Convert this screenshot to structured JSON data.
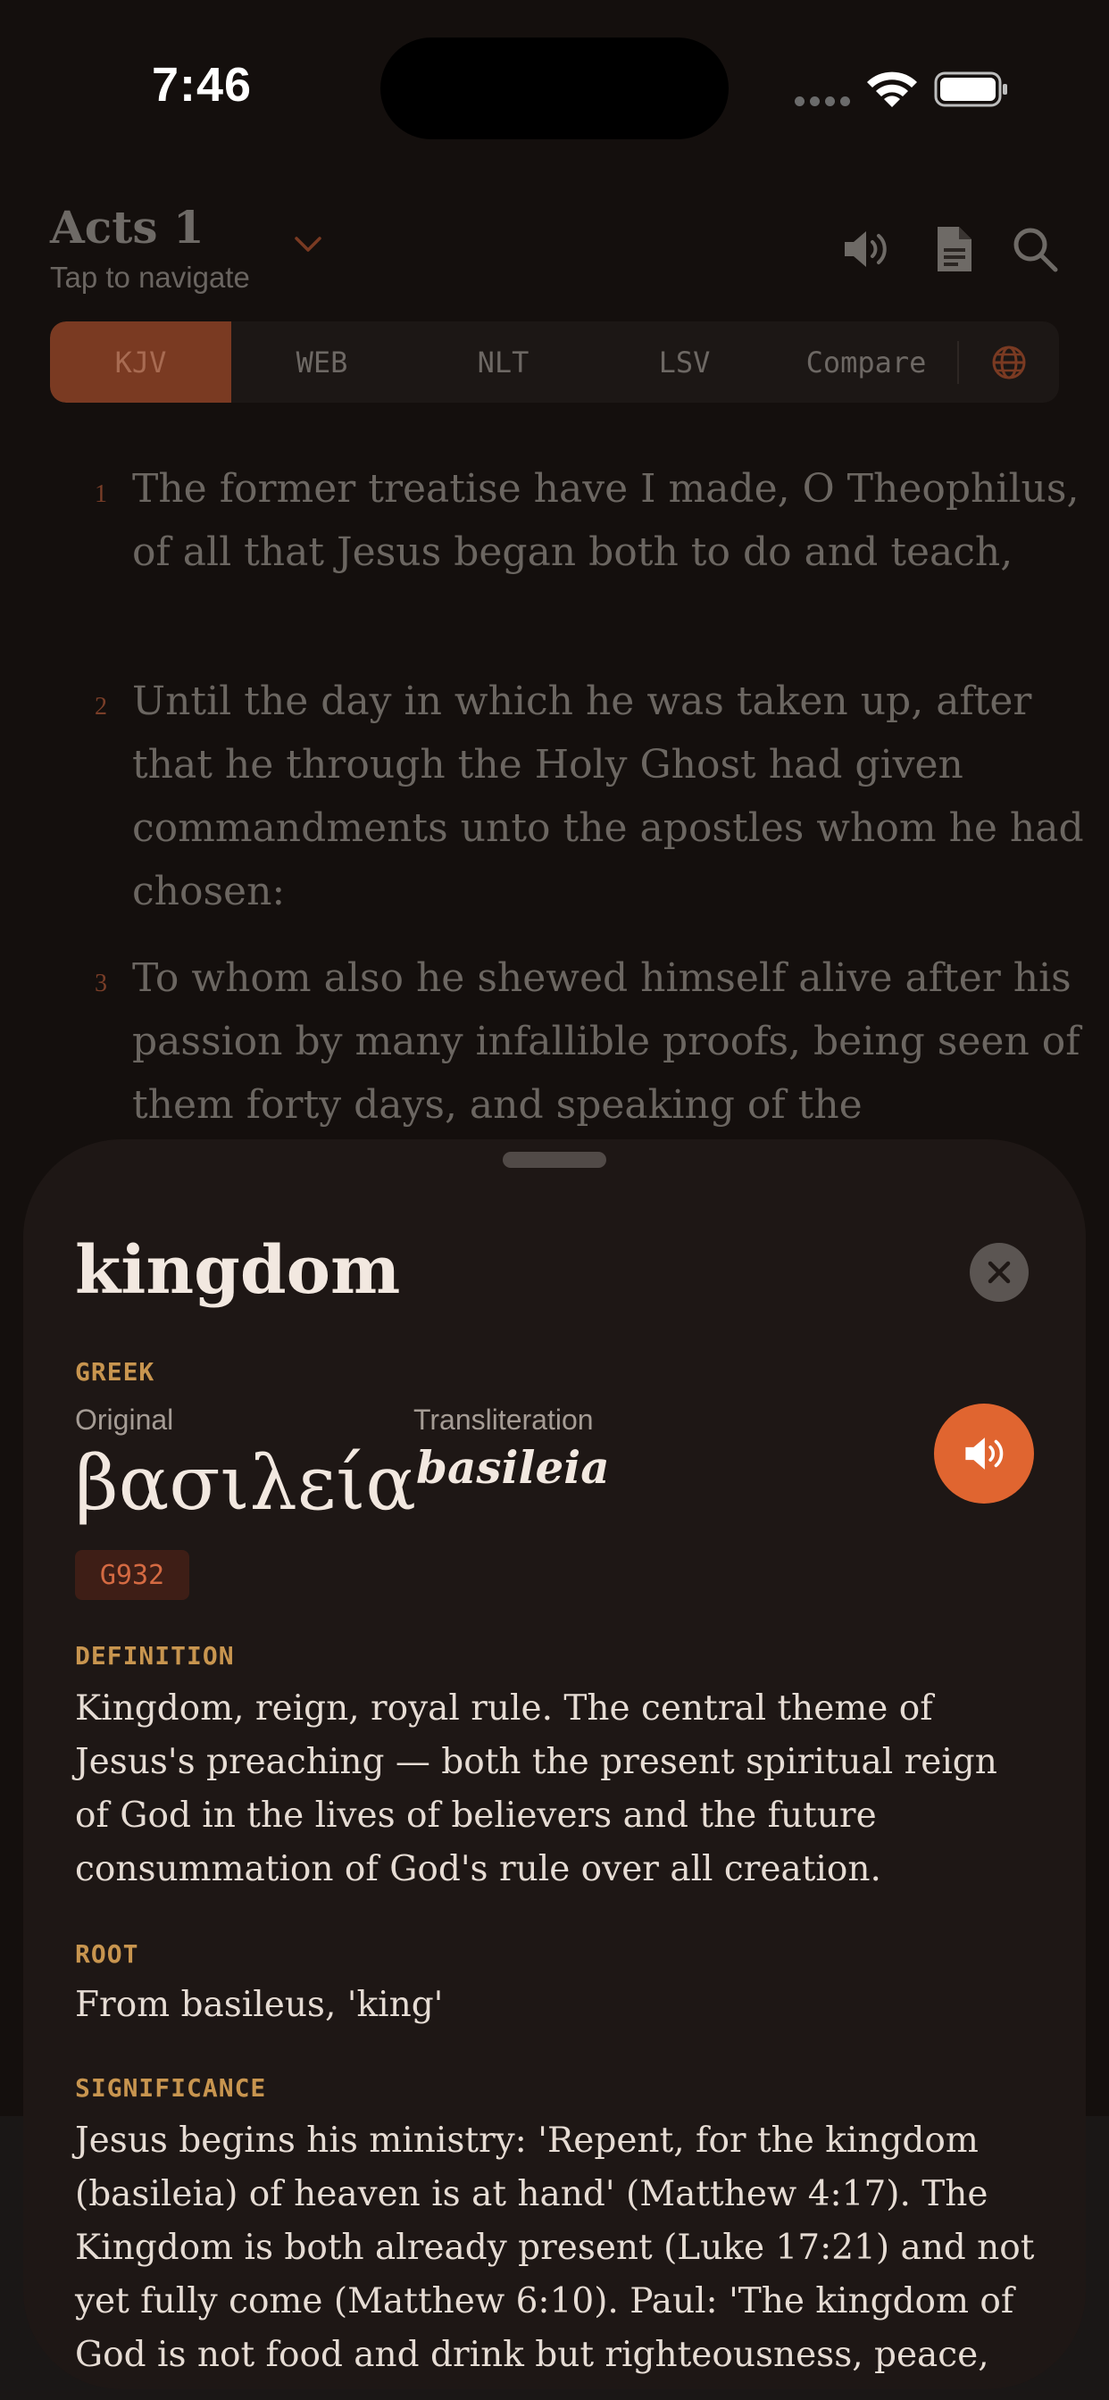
{
  "status": {
    "time": "7:46"
  },
  "header": {
    "book_title": "Acts 1",
    "subtitle": "Tap to navigate"
  },
  "icons": {
    "chevron": "chevron-down-icon",
    "speaker": "speaker-icon",
    "document": "document-icon",
    "search": "search-icon",
    "globe": "globe-icon",
    "close": "close-icon",
    "audio": "speaker-icon"
  },
  "translations": {
    "items": [
      "KJV",
      "WEB",
      "NLT",
      "LSV",
      "Compare"
    ],
    "active": "KJV"
  },
  "verses": [
    {
      "num": "1",
      "text": "The former treatise have I made, O Theophilus, of all that Jesus began both to do and teach,"
    },
    {
      "num": "2",
      "text": "Until the day in which he was taken up, after that he through the Holy Ghost had given commandments unto the apostles whom he had chosen:"
    },
    {
      "num": "3",
      "text": "To whom also he shewed himself alive after his passion by many infallible proofs, being seen of them forty days, and speaking of the"
    }
  ],
  "sheet": {
    "word": "kingdom",
    "language_label": "GREEK",
    "original_label": "Original",
    "original_word": "βασιλεία",
    "translit_label": "Transliteration",
    "transliteration": "basileia",
    "strongs": "G932",
    "definition_label": "DEFINITION",
    "definition": "Kingdom, reign, royal rule. The central theme of Jesus's preaching — both the present spiritual reign of God in the lives of believers and the future consummation of God's rule over all creation.",
    "root_label": "ROOT",
    "root": "From basileus, 'king'",
    "significance_label": "SIGNIFICANCE",
    "significance": "Jesus begins his ministry: 'Repent, for the kingdom (basileia) of heaven is at hand' (Matthew 4:17). The Kingdom is both already present (Luke 17:21) and not yet fully come (Matthew 6:10). Paul: 'The kingdom of God is not food and drink but righteousness, peace,"
  },
  "colors": {
    "accent": "#e06530",
    "label_gold": "#c8954f",
    "sheet_bg": "#1e1715"
  }
}
